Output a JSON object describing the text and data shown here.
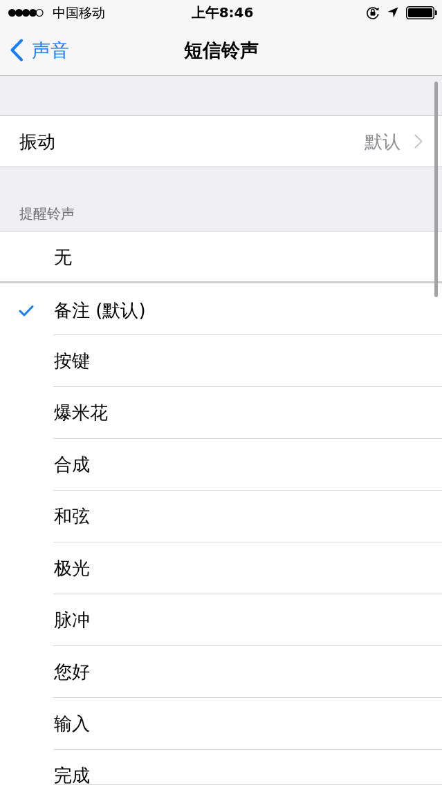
{
  "status_bar": {
    "carrier": "中国移动",
    "time": "上午8:46"
  },
  "nav_bar": {
    "back_label": "声音",
    "title": "短信铃声"
  },
  "vibration": {
    "label": "振动",
    "value": "默认"
  },
  "alert_tones": {
    "header": "提醒铃声",
    "groups": [
      {
        "items": [
          {
            "label": "无",
            "selected": false
          }
        ]
      },
      {
        "items": [
          {
            "label": "备注 (默认)",
            "selected": true
          },
          {
            "label": "按键",
            "selected": false
          },
          {
            "label": "爆米花",
            "selected": false
          },
          {
            "label": "合成",
            "selected": false
          },
          {
            "label": "和弦",
            "selected": false
          },
          {
            "label": "极光",
            "selected": false
          },
          {
            "label": "脉冲",
            "selected": false
          },
          {
            "label": "您好",
            "selected": false
          },
          {
            "label": "输入",
            "selected": false
          },
          {
            "label": "完成",
            "selected": false
          }
        ]
      }
    ]
  }
}
